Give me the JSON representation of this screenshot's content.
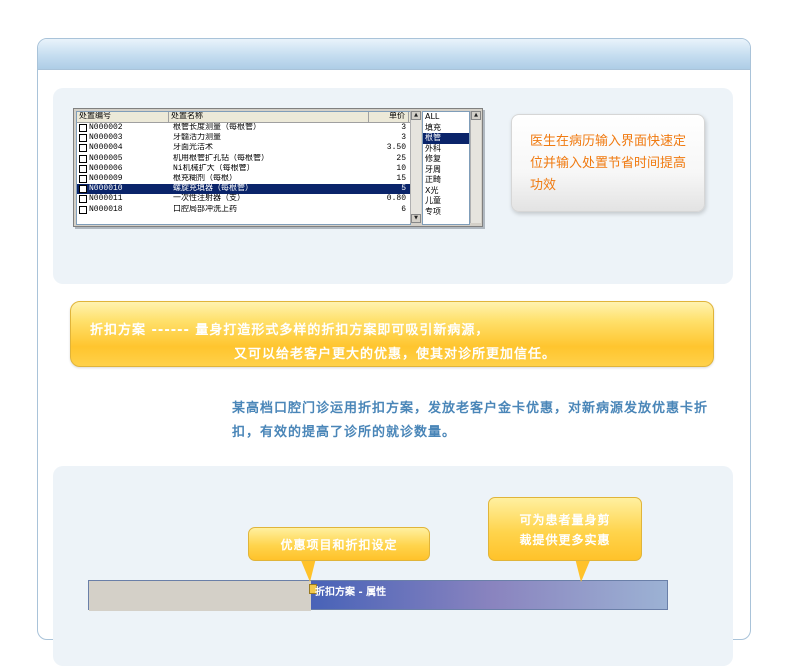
{
  "window1": {
    "columns": [
      "处置编号",
      "处置名称",
      "单价"
    ],
    "rows": [
      {
        "code": "N000002",
        "name": "根管长度测量（每根管）",
        "price": "3"
      },
      {
        "code": "N000003",
        "name": "牙髓活力测量",
        "price": "3"
      },
      {
        "code": "N000004",
        "name": "牙面光洁术",
        "price": "3.50"
      },
      {
        "code": "N000005",
        "name": "机用根管扩孔钻（每根管）",
        "price": "25"
      },
      {
        "code": "N000006",
        "name": "Ni机械扩大（每根管）",
        "price": "10"
      },
      {
        "code": "N000009",
        "name": "根充糊剂（每根）",
        "price": "15"
      },
      {
        "code": "N000010",
        "name": "螺旋充填器（每根管）",
        "price": "5"
      },
      {
        "code": "N000011",
        "name": "一次性注射器（支）",
        "price": "0.80"
      },
      {
        "code": "N000018",
        "name": "口腔局部冲洗上药",
        "price": "6"
      }
    ],
    "selected_row": 6,
    "categories": [
      "ALL",
      "填充",
      "根管",
      "外科",
      "修复",
      "牙周",
      "正畸",
      "X光",
      "儿童",
      "专项"
    ],
    "selected_category": 2
  },
  "callout1": "医生在病历输入界面快速定位并输入处置节省时间提高功效",
  "banner": {
    "line1": "折扣方案  ------  量身打造形式多样的折扣方案即可吸引新病源，",
    "line2": "又可以给老客户更大的优惠，使其对诊所更加信任。"
  },
  "body_text": "某高档口腔门诊运用折扣方案，发放老客户金卡优惠，对新病源发放优惠卡折扣，有效的提高了诊所的就诊数量。",
  "tag1": "优惠项目和折扣设定",
  "tag2": {
    "line1": "可为患者量身剪",
    "line2": "裁提供更多实惠"
  },
  "window2": {
    "title": "折扣方案 - 属性"
  },
  "colors": {
    "accent_orange": "#f07a10",
    "banner_yellow": "#ffc52e",
    "text_blue": "#4a86b8",
    "selection": "#0a246a"
  }
}
